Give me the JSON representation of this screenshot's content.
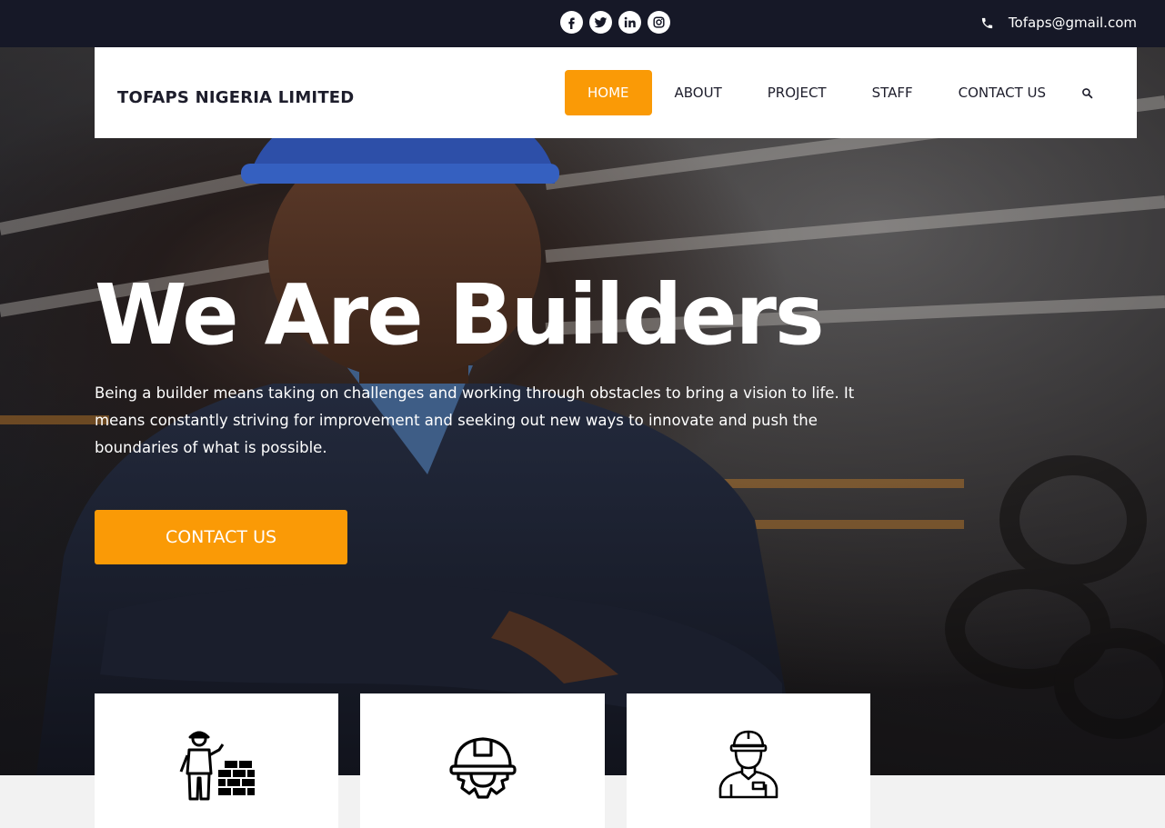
{
  "topbar": {
    "socials": [
      {
        "name": "facebook-icon",
        "glyph": "f"
      },
      {
        "name": "twitter-icon",
        "glyph": "t"
      },
      {
        "name": "linkedin-icon",
        "glyph": "in"
      },
      {
        "name": "instagram-icon",
        "glyph": "ig"
      }
    ],
    "email": "Tofaps@gmail.com",
    "phone_icon": "phone-icon"
  },
  "header": {
    "brand": "TOFAPS NIGERIA LIMITED",
    "nav": {
      "home": "HOME",
      "about": "ABOUT",
      "project": "PROJECT",
      "staff": "STAFF",
      "contact": "CONTACT US"
    },
    "search_icon": "search-icon"
  },
  "hero": {
    "title": "We Are Builders",
    "text": "Being a builder means taking on challenges and working through obstacles to bring a vision to life. It means constantly striving for improvement and seeking out new ways to innovate and push the boundaries of what is possible.",
    "cta": "CONTACT US"
  },
  "features": [
    {
      "icon": "bricklayer-icon"
    },
    {
      "icon": "helmet-gear-icon"
    },
    {
      "icon": "worker-icon"
    }
  ],
  "colors": {
    "accent": "#fa9a06",
    "topbar": "#161827",
    "text_dark": "#1d1d2b"
  }
}
